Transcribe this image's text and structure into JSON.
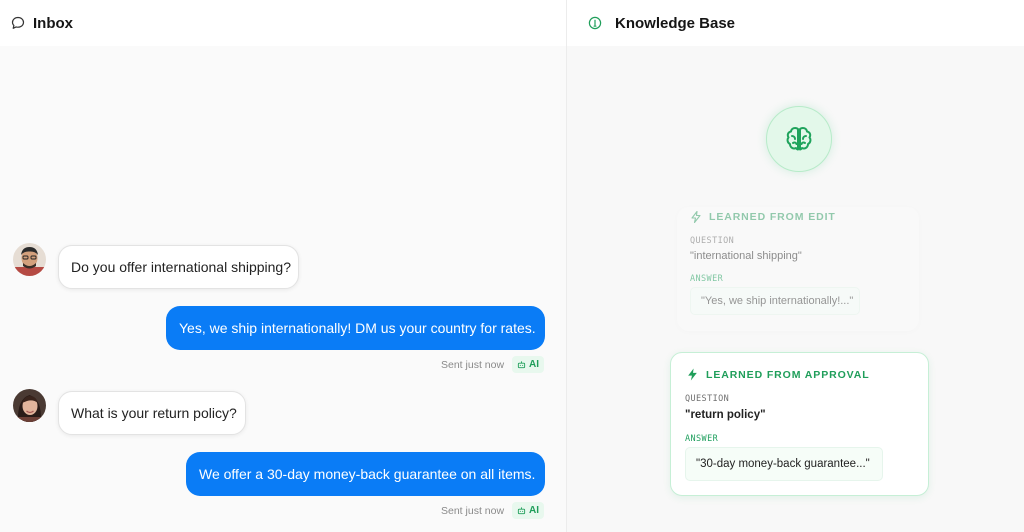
{
  "inbox": {
    "title": "Inbox",
    "messages": [
      {
        "direction": "incoming",
        "text": "Do you offer international shipping?"
      },
      {
        "direction": "outgoing",
        "text": "Yes, we ship internationally! DM us your country for rates.",
        "status": "Sent just now",
        "badge": "AI"
      },
      {
        "direction": "incoming",
        "text": "What is your return policy?"
      },
      {
        "direction": "outgoing",
        "text": "We offer a 30-day money-back guarantee on all items.",
        "status": "Sent just now",
        "badge": "AI"
      }
    ]
  },
  "knowledge_base": {
    "title": "Knowledge Base",
    "entries": [
      {
        "source": "LEARNED FROM EDIT",
        "question_label": "QUESTION",
        "question": "\"international shipping\"",
        "answer_label": "ANSWER",
        "answer": "\"Yes, we ship internationally!...\""
      },
      {
        "source": "LEARNED FROM APPROVAL",
        "question_label": "QUESTION",
        "question": "\"return policy\"",
        "answer_label": "ANSWER",
        "answer": "\"30-day money-back guarantee...\""
      }
    ]
  },
  "colors": {
    "accent_blue": "#0a7cf6",
    "accent_green": "#1f9e5a",
    "background": "#fafafa"
  },
  "icons": {
    "inbox": "chat-bubble-icon",
    "knowledge_base": "lightbulb-icon",
    "brain": "brain-icon",
    "learned": "lightning-icon",
    "ai": "robot-icon"
  }
}
